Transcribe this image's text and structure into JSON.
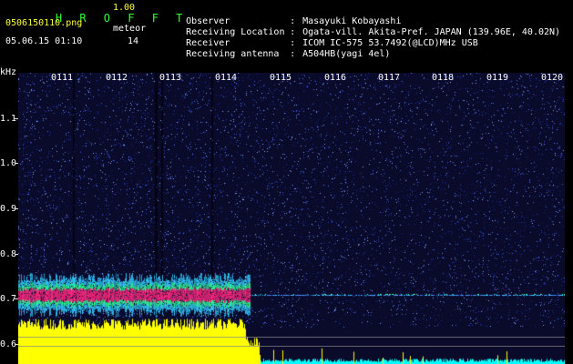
{
  "header": {
    "brand": "H R O F F T",
    "version": "1.00",
    "filename": "0506150110.png",
    "meteor_label": "meteor",
    "datetime": "05.06.15 01:10",
    "meteor_count": "14",
    "colors": {
      "brand": "#33ff33",
      "version": "#ffff33",
      "fields": "#ffffff"
    }
  },
  "info": [
    {
      "key": "Observer",
      "sep": ":",
      "value": "Masayuki Kobayashi"
    },
    {
      "key": "Receiving Location",
      "sep": ":",
      "value": "Ogata-vill. Akita-Pref. JAPAN (139.96E, 40.02N)"
    },
    {
      "key": "Receiver",
      "sep": ":",
      "value": "ICOM IC-575 53.7492(@LCD)MHz USB"
    },
    {
      "key": "Receiving antenna",
      "sep": ":",
      "value": "A504HB(yagi 4el)"
    }
  ],
  "spectrogram": {
    "y_unit": "kHz",
    "y_ticks": [
      "1.1",
      "1.0",
      "0.9",
      "0.8",
      "0.7",
      "0.6"
    ],
    "x_ticks": [
      "0111",
      "0112",
      "0113",
      "0114",
      "0115",
      "0116",
      "0117",
      "0118",
      "0119",
      "0120"
    ],
    "colors": {
      "background": "#0a0a2a",
      "noise_low": "#1a2a9a",
      "noise_high": "#4a7aff",
      "band_core": "#ff2a80",
      "band_mid": "#33ff99",
      "band_outer": "#33ccff",
      "power": "#ffff00",
      "power_low": "#00ffff"
    }
  }
}
